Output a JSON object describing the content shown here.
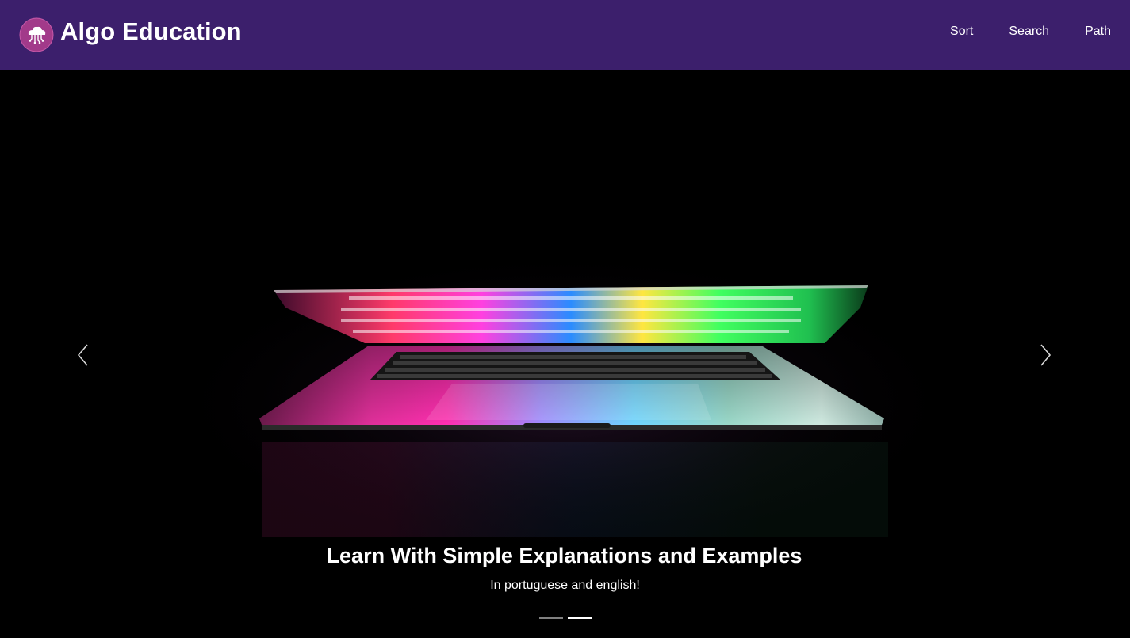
{
  "colors": {
    "navbar_bg": "#3c1f6c",
    "logo_bg": "#a23a8a",
    "text": "#ffffff"
  },
  "brand": {
    "title": "Algo Education",
    "logo_icon": "cloud-circuit-icon"
  },
  "nav": {
    "items": [
      {
        "label": "Sort"
      },
      {
        "label": "Search"
      },
      {
        "label": "Path"
      }
    ]
  },
  "carousel": {
    "prev_icon": "chevron-left-icon",
    "next_icon": "chevron-right-icon",
    "slide": {
      "image": "laptop-neon-keyboard-photo",
      "title": "Learn With Simple Explanations and Examples",
      "subtitle": "In portuguese and english!"
    },
    "indicators": [
      {
        "active": false
      },
      {
        "active": true
      }
    ]
  }
}
